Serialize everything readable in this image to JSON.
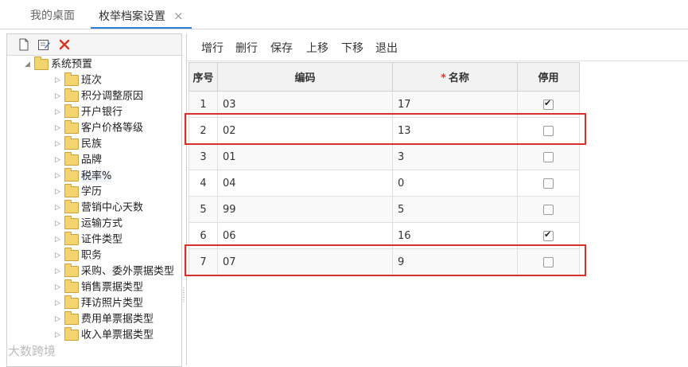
{
  "tabs": [
    {
      "label": "我的桌面"
    },
    {
      "label": "枚举档案设置",
      "close": "×"
    }
  ],
  "left_toolbar": {
    "icons": [
      "new-file-icon",
      "edit-icon",
      "delete-icon"
    ]
  },
  "tree": {
    "root": {
      "label": "系统预置"
    },
    "children": [
      {
        "label": "班次"
      },
      {
        "label": "积分调整原因"
      },
      {
        "label": "开户银行"
      },
      {
        "label": "客户价格等级"
      },
      {
        "label": "民族"
      },
      {
        "label": "品牌"
      },
      {
        "label": "税率%",
        "selected": true
      },
      {
        "label": "学历"
      },
      {
        "label": "营销中心天数"
      },
      {
        "label": "运输方式"
      },
      {
        "label": "证件类型"
      },
      {
        "label": "职务"
      },
      {
        "label": "采购、委外票据类型"
      },
      {
        "label": "销售票据类型"
      },
      {
        "label": "拜访照片类型"
      },
      {
        "label": "费用单票据类型"
      },
      {
        "label": "收入单票据类型"
      }
    ]
  },
  "toolbar": {
    "add_row": "增行",
    "delete_row": "删行",
    "save": "保存",
    "move_up": "上移",
    "move_down": "下移",
    "exit": "退出"
  },
  "grid": {
    "headers": {
      "seq": "序号",
      "code": "编码",
      "name_required_mark": "*",
      "name": "名称",
      "disabled": "停用"
    },
    "rows": [
      {
        "seq": "1",
        "code": "03",
        "name": "17",
        "disabled": true
      },
      {
        "seq": "2",
        "code": "02",
        "name": "13",
        "disabled": false
      },
      {
        "seq": "3",
        "code": "01",
        "name": "3",
        "disabled": false
      },
      {
        "seq": "4",
        "code": "04",
        "name": "0",
        "disabled": false
      },
      {
        "seq": "5",
        "code": "99",
        "name": "5",
        "disabled": false
      },
      {
        "seq": "6",
        "code": "06",
        "name": "16",
        "disabled": true
      },
      {
        "seq": "7",
        "code": "07",
        "name": "9",
        "disabled": false
      }
    ]
  },
  "highlight_color": "#d9302c",
  "watermark": "大数跨境"
}
